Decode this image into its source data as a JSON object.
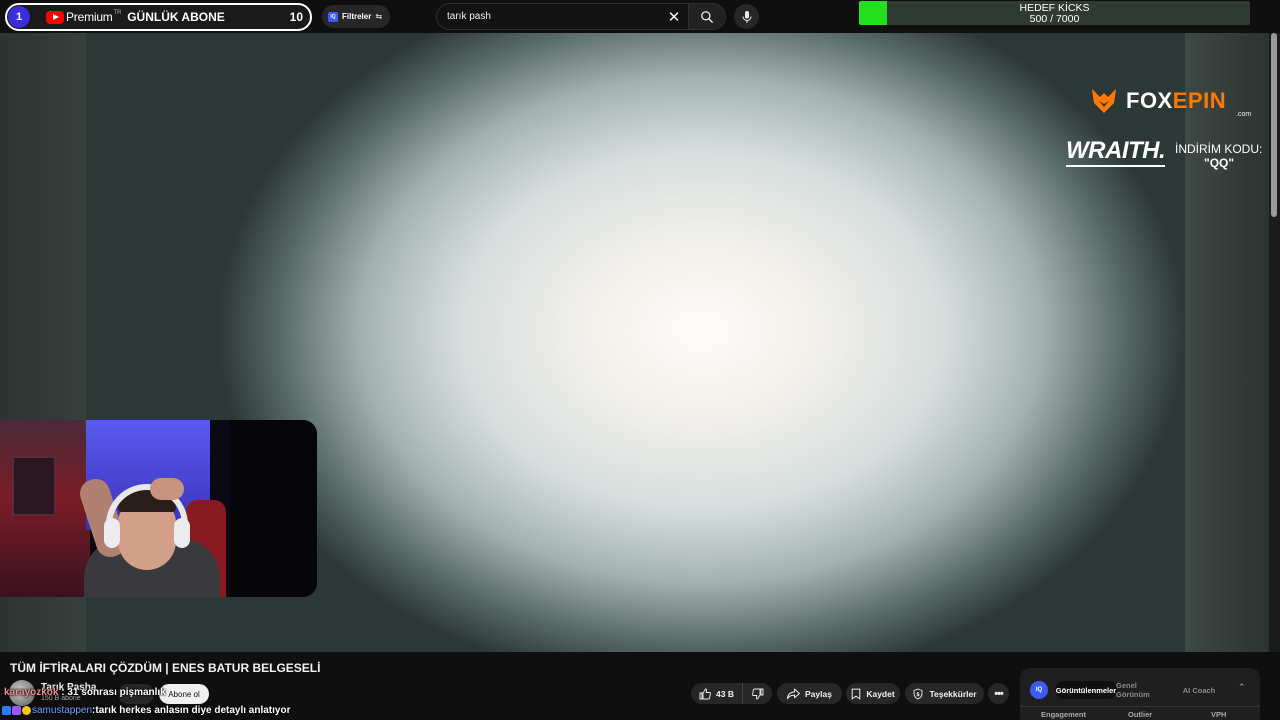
{
  "subscriber_widget": {
    "rank": "1",
    "brand": "Premium",
    "brand_region": "TR",
    "label": "GÜNLÜK ABONE",
    "count": "10"
  },
  "filter_button": {
    "badge": "IQ",
    "label": "Filtreler"
  },
  "search": {
    "value": "tarık pash"
  },
  "goal_widget": {
    "title": "HEDEF KİCKS",
    "progress_text": "500 / 7000",
    "progress_fraction": 0.0714,
    "fill_color": "#22e01c"
  },
  "sponsor": {
    "brand_pre": "FOX",
    "brand_post": "EPIN",
    "brand_suffix": ".com",
    "partner": "WRAITH.",
    "code_label": "İNDİRİM KODU:",
    "code": "\"QQ\"",
    "accent_color": "#ff7a00"
  },
  "video": {
    "title": "TÜM İFTİRALARI ÇÖZDÜM | ENES BATUR BELGESELİ",
    "channel_name": "Tarık Pasha",
    "channel_subs": "150 B abone",
    "subscribe_label": "Abone ol"
  },
  "actions": {
    "like_count": "43 B",
    "share_label": "Paylaş",
    "save_label": "Kaydet",
    "thanks_label": "Teşekkürler"
  },
  "chat": [
    {
      "user": "karayozkok",
      "sep": " : ",
      "message": "31 sonrası pişmanlık"
    },
    {
      "user": "samustappen",
      "sep": " : ",
      "message": "tarık herkes anlasın diye detaylı anlatıyor"
    }
  ],
  "analytics": {
    "badge": "IQ",
    "tabs": [
      "Görüntülenmeler",
      "Genel Görünüm",
      "AI Coach"
    ],
    "columns": [
      "Engagement",
      "Outlier",
      "VPH"
    ]
  }
}
